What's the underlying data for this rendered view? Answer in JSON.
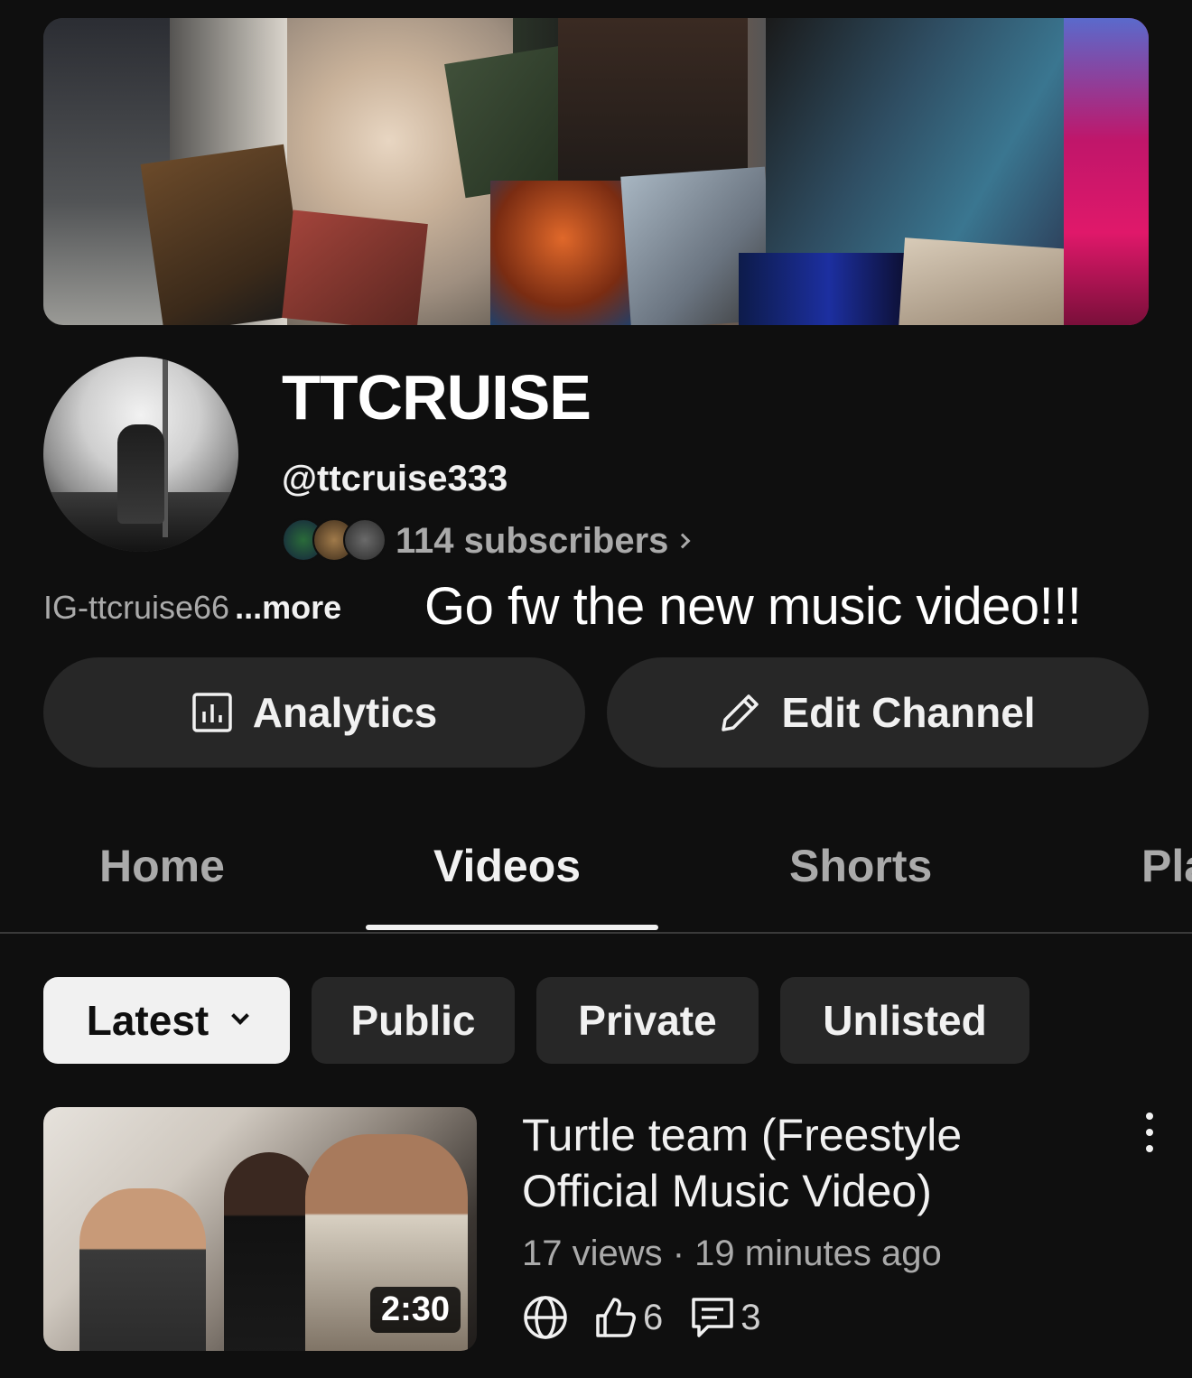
{
  "channel": {
    "name": "TTCRUISE",
    "handle": "@ttcruise333",
    "subscribers": "114 subscribers",
    "description": "IG-ttcruise66",
    "more_label": "...more"
  },
  "overlay_caption": "Go fw the new music video!!!",
  "actions": {
    "analytics_label": "Analytics",
    "edit_label": "Edit Channel"
  },
  "tabs": [
    {
      "label": "Home"
    },
    {
      "label": "Videos"
    },
    {
      "label": "Shorts"
    },
    {
      "label": "Pla"
    }
  ],
  "active_tab": "Videos",
  "filters": [
    {
      "label": "Latest"
    },
    {
      "label": "Public"
    },
    {
      "label": "Private"
    },
    {
      "label": "Unlisted"
    }
  ],
  "video": {
    "title": "Turtle team (Freestyle Official Music Video)",
    "views": "17 views",
    "age": "19 minutes ago",
    "meta_separator": " · ",
    "duration": "2:30",
    "likes": "6",
    "comments": "3",
    "visibility_icon": "globe-icon"
  },
  "colors": {
    "background": "#0f0f0f",
    "button_bg": "#272727",
    "text_primary": "#f1f1f1",
    "text_secondary": "#aaaaaa"
  }
}
